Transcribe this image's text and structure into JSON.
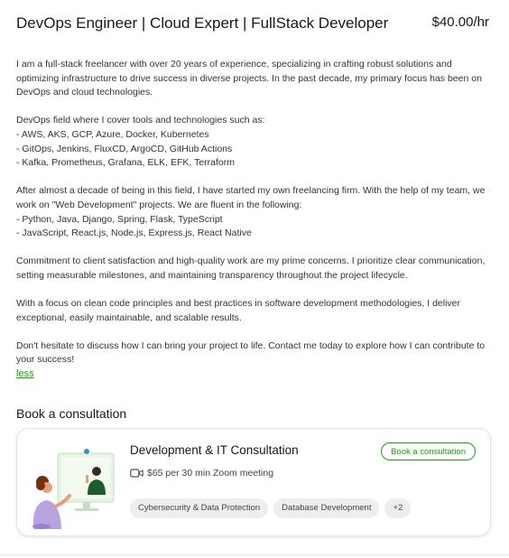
{
  "profile": {
    "title": "DevOps Engineer | Cloud Expert | FullStack Developer",
    "rate": "$40.00/hr"
  },
  "bio": {
    "paragraphs": [
      [
        "I am a full-stack freelancer with over 20 years of experience, specializing in crafting robust solutions and optimizing infrastructure to drive success in diverse projects. In the past decade, my primary focus has been on DevOps and cloud technologies."
      ],
      [
        "DevOps field where I cover tools and technologies such as:",
        "- AWS, AKS, GCP, Azure, Docker, Kubernetes",
        "- GitOps, Jenkins, FluxCD, ArgoCD, GitHub Actions",
        "- Kafka, Prometheus, Grafana, ELK, EFK, Terraform"
      ],
      [
        "After almost a decade of being in this field, I have started my own freelancing firm. With the help of my team, we work on \"Web Development\" projects. We are fluent in the following:",
        "- Python, Java, Django, Spring, Flask, TypeScript",
        "- JavaScript, React.js, Node.js, Express.js, React Native"
      ],
      [
        "Commitment to client satisfaction and high-quality work are my prime concerns. I prioritize clear communication, setting measurable milestones, and maintaining transparency throughout the project lifecycle."
      ],
      [
        "With a focus on clean code principles and best practices in software development methodologies, I deliver exceptional, easily maintainable, and scalable results."
      ],
      [
        "Don't hesitate to discuss how I can bring your project to life. Contact me today to explore how I can contribute to your success!"
      ]
    ],
    "toggle_label": "less"
  },
  "consultation": {
    "section_title": "Book a consultation",
    "card_title": "Development & IT Consultation",
    "book_label": "Book a consultation",
    "price": "$65 per 30 min Zoom meeting",
    "icon": "video-camera-icon",
    "tags": [
      "Cybersecurity & Data Protection",
      "Database Development",
      "+2"
    ]
  },
  "colors": {
    "accent": "#14a800"
  }
}
